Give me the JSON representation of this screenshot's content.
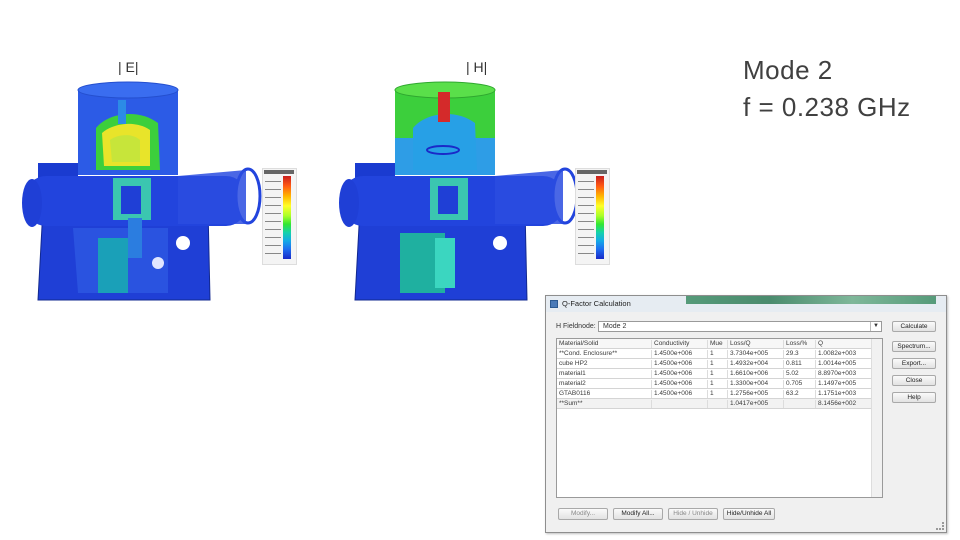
{
  "labels": {
    "e_field": "| E|",
    "h_field": "| H|"
  },
  "mode": {
    "line1": "Mode  2",
    "line2": "f = 0.238 GHz"
  },
  "colors": {
    "cavity_blue": "#1f3fd6",
    "field_hot": "#d42a2a",
    "field_mid": "#e8e42a",
    "field_green": "#3bd23b"
  },
  "dialog": {
    "title": "Q-Factor Calculation",
    "efield_label": "H Fieldnode:",
    "efield_value": "Mode 2",
    "buttons": {
      "calculate": "Calculate",
      "spectrum": "Spectrum...",
      "export": "Export...",
      "close": "Close",
      "help": "Help"
    },
    "columns": [
      "Material/Solid",
      "Conductivity",
      "Mue",
      "Loss/Q",
      "Loss/%",
      "Q"
    ],
    "rows": [
      [
        "**Cond. Enclosure**",
        "1.4500e+006",
        "1",
        "3.7304e+005",
        "29.3",
        "1.0082e+003"
      ],
      [
        "cube HP2",
        "1.4500e+006",
        "1",
        "1.4932e+004",
        "0.811",
        "1.0014e+005"
      ],
      [
        "material1",
        "1.4500e+006",
        "1",
        "1.6610e+006",
        "5.02",
        "8.8970e+003"
      ],
      [
        "material2",
        "1.4500e+006",
        "1",
        "1.3300e+004",
        "0.705",
        "1.1497e+005"
      ],
      [
        "GTAB0116",
        "1.4500e+006",
        "1",
        "1.2756e+005",
        "63.2",
        "1.1751e+003"
      ],
      [
        "**Sum**",
        "",
        "",
        "1.0417e+005",
        "",
        "8.1456e+002"
      ]
    ],
    "bottom_buttons": {
      "modify": "Modify...",
      "modify_all": "Modify All...",
      "hide_unhide": "Hide / Unhide",
      "hide_unhide_all": "Hide/Unhide All"
    }
  }
}
